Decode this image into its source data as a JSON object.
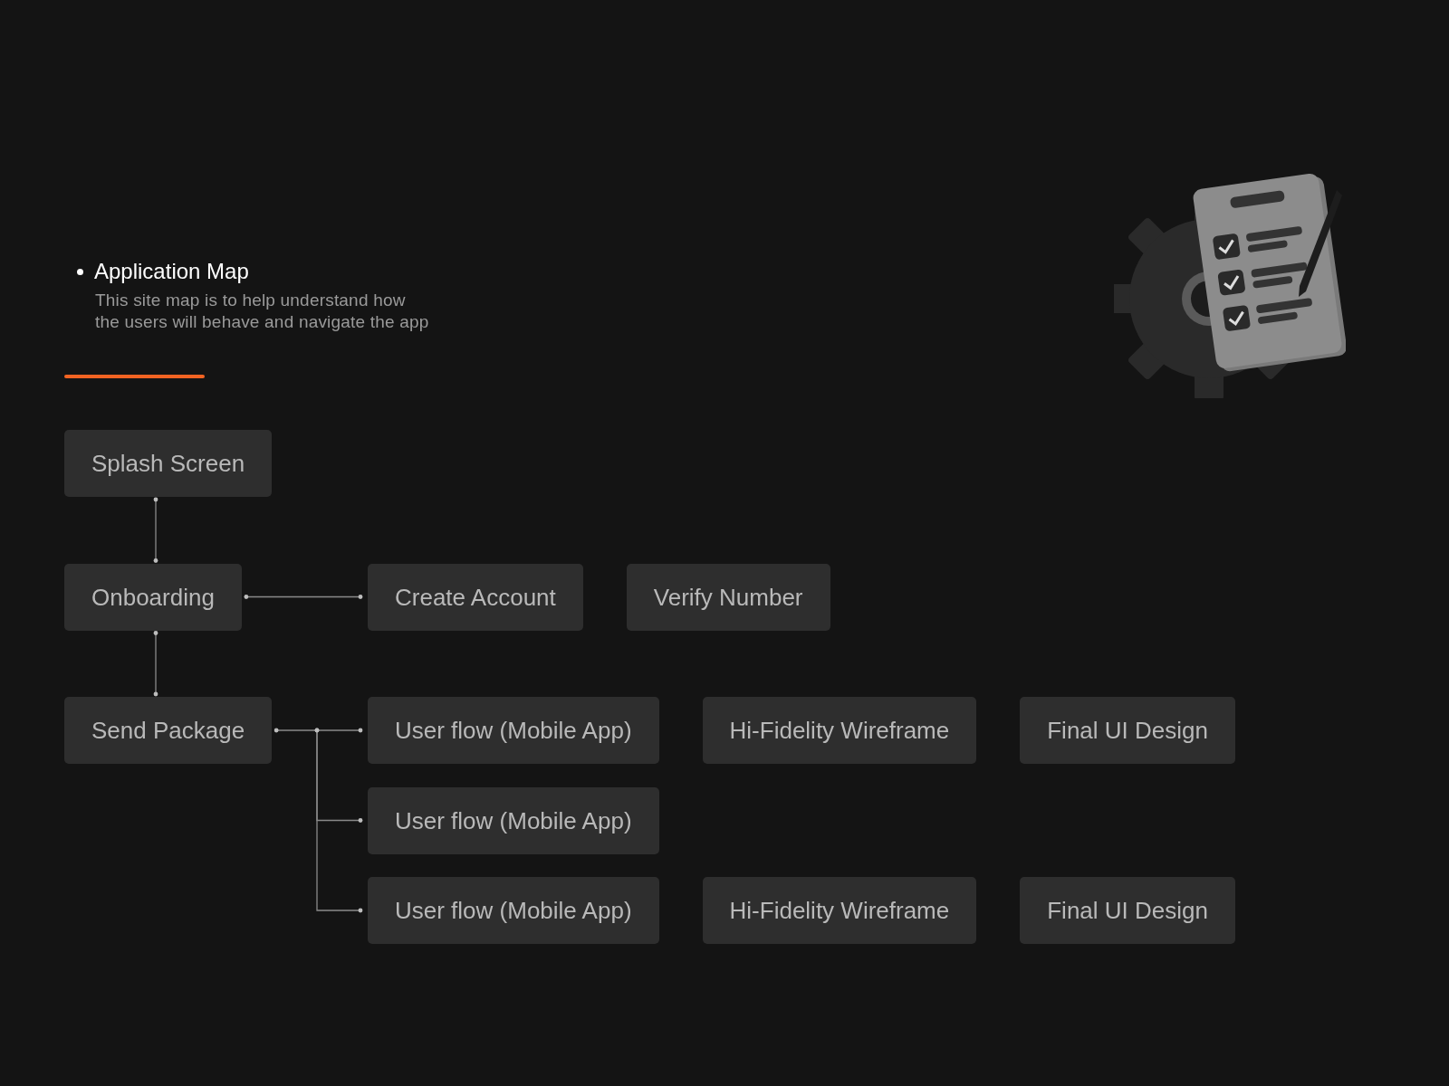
{
  "header": {
    "title": "Application Map",
    "description": "This site map is to help understand how\nthe users will behave and navigate the app"
  },
  "sitemap": [
    {
      "label": "Splash Screen"
    },
    {
      "label": "Onboarding",
      "branches": [
        [
          "Create Account",
          "Verify Number"
        ]
      ]
    },
    {
      "label": "Send Package",
      "branches": [
        [
          "User flow (Mobile App)",
          "Hi-Fidelity Wireframe",
          "Final UI Design"
        ],
        [
          "User flow (Mobile App)"
        ],
        [
          "User flow (Mobile App)",
          "Hi-Fidelity Wireframe",
          "Final UI Design"
        ]
      ]
    }
  ]
}
